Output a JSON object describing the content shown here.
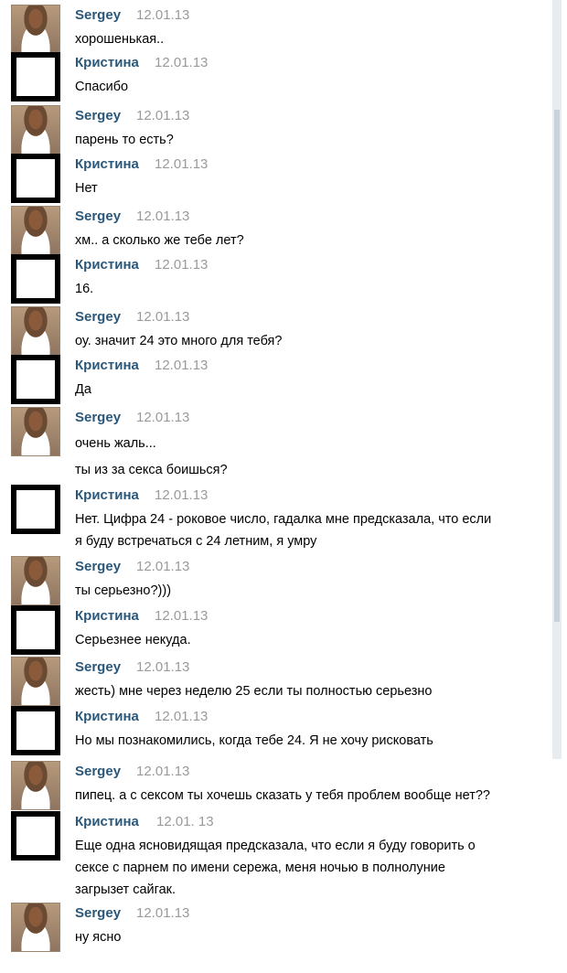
{
  "messages": [
    {
      "author": "Sergey",
      "date": "12.01.13",
      "lines": [
        "хорошенькая.."
      ]
    },
    {
      "author": "Кристина",
      "date": "12.01.13",
      "lines": [
        "Спасибо"
      ]
    },
    {
      "author": "Sergey",
      "date": "12.01.13",
      "lines": [
        "парень то есть?"
      ]
    },
    {
      "author": "Кристина",
      "date": "12.01.13",
      "lines": [
        "Нет"
      ]
    },
    {
      "author": "Sergey",
      "date": "12.01.13",
      "lines": [
        "хм.. а сколько же тебе лет?"
      ]
    },
    {
      "author": "Кристина",
      "date": "12.01.13",
      "lines": [
        "16."
      ]
    },
    {
      "author": "Sergey",
      "date": "12.01.13",
      "lines": [
        "оу. значит 24 это много для тебя?"
      ]
    },
    {
      "author": "Кристина",
      "date": "12.01.13",
      "lines": [
        "Да"
      ]
    },
    {
      "author": "Sergey",
      "date": "12.01.13",
      "lines": [
        "очень жаль...",
        "ты из за секса боишься?"
      ]
    },
    {
      "author": "Кристина",
      "date": "12.01.13",
      "lines": [
        "Нет. Цифра 24 - роковое число, гадалка мне предсказала, что если",
        "я буду встречаться с 24 летним, я умру"
      ]
    },
    {
      "author": "Sergey",
      "date": "12.01.13",
      "lines": [
        "ты серьезно?)))"
      ]
    },
    {
      "author": "Кристина",
      "date": "12.01.13",
      "lines": [
        "Серьезнее некуда."
      ]
    },
    {
      "author": "Sergey",
      "date": "12.01.13",
      "lines": [
        "жесть) мне через неделю 25 если ты полностью серьезно"
      ]
    },
    {
      "author": "Кристина",
      "date": "12.01.13",
      "lines": [
        "Но мы познакомились, когда тебе 24. Я не хочу рисковать"
      ]
    },
    {
      "author": "Sergey",
      "date": "12.01.13",
      "lines": [
        "пипец. а с сексом ты хочешь сказать у тебя проблем вообще нет??"
      ]
    },
    {
      "author": "Кристина",
      "date": "12.01. 13",
      "lines": [
        "Еще одна ясновидящая предсказала, что если я буду говорить о",
        "сексе с парнем по имени сережа, меня ночью в полнолуние",
        "загрызет сайгак."
      ]
    },
    {
      "author": "Sergey",
      "date": "12.01.13",
      "lines": [
        "ну ясно"
      ]
    }
  ]
}
